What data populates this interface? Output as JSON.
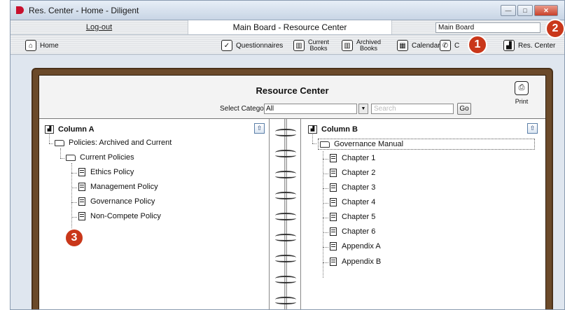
{
  "window": {
    "title": "Res. Center - Home - Diligent",
    "minimize": "—",
    "maximize": "□",
    "close": "✕"
  },
  "tabs": {
    "logout": "Log-out",
    "board_title": "Main Board - Resource Center",
    "board_select": "Main Board"
  },
  "toolbar": {
    "home": "Home",
    "questionnaires": "Questionnaires",
    "current_books_1": "Current",
    "current_books_2": "Books",
    "archived_books_1": "Archived",
    "archived_books_2": "Books",
    "calendar": "Calendar",
    "contacts": "C",
    "res_center": "Res. Center"
  },
  "callouts": [
    "1",
    "2",
    "3"
  ],
  "resource_center": {
    "title": "Resource Center",
    "category_label": "Select Category",
    "category_value": "All",
    "search_placeholder": "Search",
    "go": "Go",
    "print": "Print"
  },
  "column_a": {
    "title": "Column A",
    "root": "Policies: Archived and Current",
    "folder": "Current Policies",
    "items": [
      "Ethics Policy",
      "Management Policy",
      "Governance Policy",
      "Non-Compete Policy"
    ]
  },
  "column_b": {
    "title": "Column B",
    "root": "Governance Manual",
    "items": [
      "Chapter 1",
      "Chapter 2",
      "Chapter 3",
      "Chapter 4",
      "Chapter 5",
      "Chapter 6",
      "Appendix A",
      "Appendix B"
    ]
  },
  "colors": {
    "accent": "#c9371a",
    "frame": "#6b4a2a"
  }
}
